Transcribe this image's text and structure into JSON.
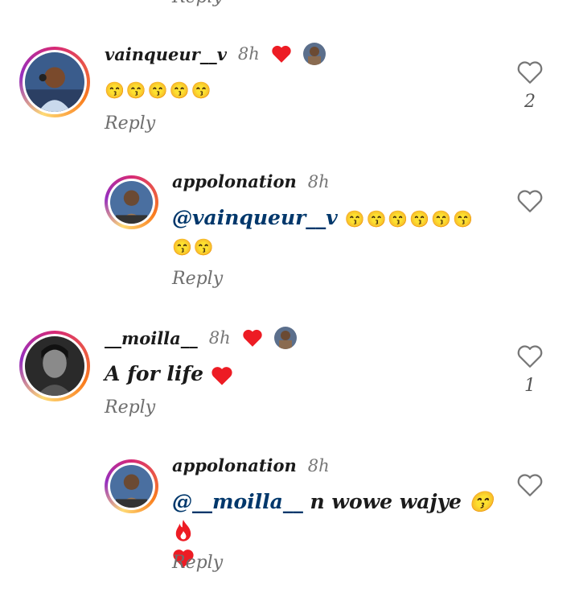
{
  "top_reply": "Reply",
  "comments": [
    {
      "username": "vainqueur__v",
      "time": "8h",
      "text": "😙😙😙😙😙",
      "reply_label": "Reply",
      "like_count": "2",
      "liked_by_creator": true
    },
    {
      "username": "appolonation",
      "time": "8h",
      "mention": "@vainqueur__v",
      "text": "😙😙😙😙😙😙",
      "text_line2": "😙😙",
      "reply_label": "Reply"
    },
    {
      "username": "__moilla__",
      "time": "8h",
      "text": "A for life",
      "reply_label": "Reply",
      "like_count": "1",
      "liked_by_creator": true
    },
    {
      "username": "appolonation",
      "time": "8h",
      "mention": "@__moilla__",
      "text": "n wowe wajye 😙",
      "reply_label": "Reply"
    }
  ],
  "colors": {
    "mention": "#00376b",
    "heart_red": "#ed1c24",
    "muted": "#6e6e6e"
  },
  "icons": {
    "like": "heart-outline-icon",
    "creator_like": "heart-filled-icon",
    "fire": "fire-icon"
  }
}
